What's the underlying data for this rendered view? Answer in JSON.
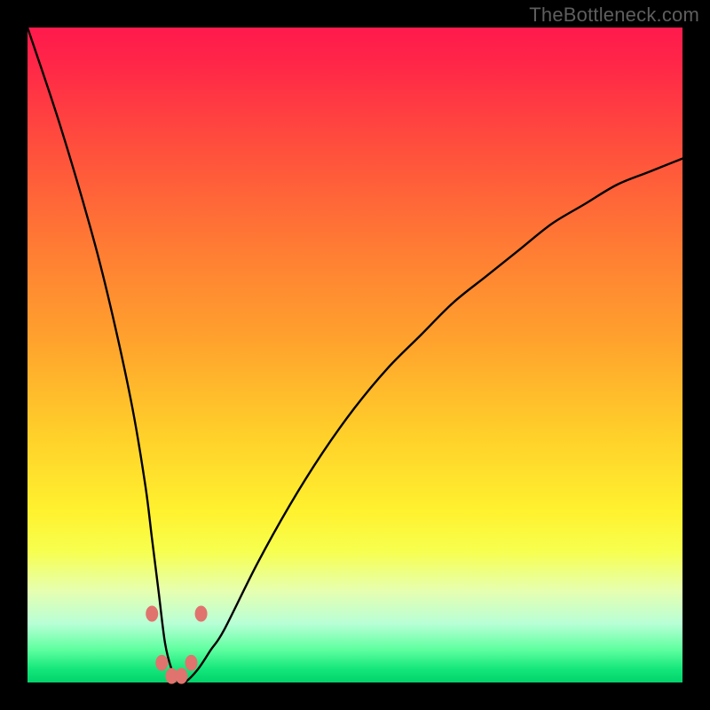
{
  "watermark": "TheBottleneck.com",
  "colors": {
    "frame": "#000000",
    "gradient_top": "#ff1a4d",
    "gradient_bottom": "#02d36b",
    "curve": "#000000",
    "markers": "#e0736e"
  },
  "chart_data": {
    "type": "line",
    "title": "",
    "xlabel": "",
    "ylabel": "",
    "xlim": [
      0,
      100
    ],
    "ylim": [
      0,
      100
    ],
    "x": [
      0,
      5,
      10,
      13,
      16,
      18,
      19,
      20,
      21,
      22,
      23,
      24,
      26,
      28,
      30,
      35,
      40,
      45,
      50,
      55,
      60,
      65,
      70,
      75,
      80,
      85,
      90,
      95,
      100
    ],
    "values": [
      100,
      85,
      68,
      56,
      42,
      30,
      22,
      14,
      6,
      2,
      0,
      0,
      2,
      5,
      8,
      18,
      27,
      35,
      42,
      48,
      53,
      58,
      62,
      66,
      70,
      73,
      76,
      78,
      80
    ],
    "markers": [
      {
        "x": 19.0,
        "y": 10.5
      },
      {
        "x": 20.5,
        "y": 3.0
      },
      {
        "x": 22.0,
        "y": 1.0
      },
      {
        "x": 23.5,
        "y": 1.0
      },
      {
        "x": 25.0,
        "y": 3.0
      },
      {
        "x": 26.5,
        "y": 10.5
      }
    ]
  }
}
